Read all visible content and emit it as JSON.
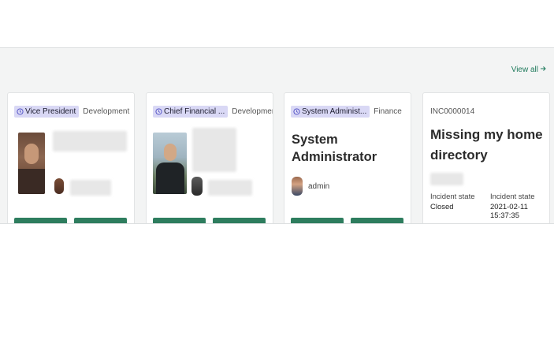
{
  "header": {
    "view_all_label": "View all"
  },
  "cards": [
    {
      "tag": "Vice President",
      "department": "Development",
      "action_1": "",
      "action_2": ""
    },
    {
      "tag": "Chief Financial ...",
      "department": "Development",
      "action_1": "",
      "action_2": ""
    },
    {
      "tag": "System Administ...",
      "department": "Finance",
      "name": "System Administrator",
      "user_id": "admin"
    },
    {
      "number": "INC0000014",
      "title_line1": "Missing my home",
      "title_line2": "directory",
      "fields": [
        {
          "label": "Incident state",
          "value": "Closed"
        },
        {
          "label": "Incident state",
          "value": "2021-02-11 15:37:35"
        }
      ]
    }
  ],
  "colors": {
    "accent": "#2e7d5e",
    "tag_bg": "#d9d8f5",
    "link": "#1f7a5c"
  },
  "icons": {
    "tag": "clock-icon",
    "view_all": "arrow-right-icon"
  }
}
